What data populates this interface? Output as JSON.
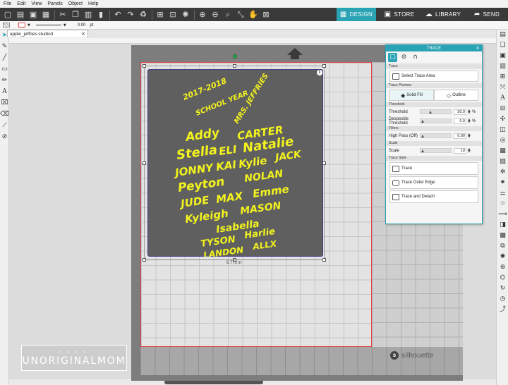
{
  "menu": [
    "File",
    "Edit",
    "View",
    "Panels",
    "Object",
    "Help"
  ],
  "nav_tabs": [
    {
      "label": "DESIGN",
      "active": true
    },
    {
      "label": "STORE",
      "active": false
    },
    {
      "label": "LIBRARY",
      "active": false
    },
    {
      "label": "SEND",
      "active": false
    }
  ],
  "properties": {
    "line_width": "0.00",
    "line_unit": "pt"
  },
  "document_tab": "apple_jeffries.studio3",
  "artwork": {
    "header": [
      "2017-2018",
      "SCHOOL YEAR",
      "MRS. JEFFRIES"
    ],
    "names": [
      "Addy",
      "CARTER",
      "Stella",
      "ELI",
      "Natalie",
      "JONNY",
      "KAI",
      "Kylie",
      "JACK",
      "Peyton",
      "NOLAN",
      "JUDE",
      "MAX",
      "Emme",
      "Kyleigh",
      "MASON",
      "Isabella",
      "TYSON",
      "Harlie",
      "LANDON",
      "ALLX"
    ],
    "width_label": "8.773 in"
  },
  "brand": "silhouette",
  "watermark": "UNORIGINALMOM",
  "trace_panel": {
    "title": "TRACE",
    "sections": {
      "trace": "Trace",
      "preview": "Trace Preview",
      "threshold": "Threshold",
      "filters": "Filters",
      "scale": "Scale",
      "style": "Trace Style"
    },
    "select_area": "Select Trace Area",
    "preview_options": [
      "Solid Fill",
      "Outline"
    ],
    "threshold": {
      "label": "Threshold",
      "value": "30.0",
      "unit": "%",
      "fraction": 0.3
    },
    "despeckle": {
      "label": "Despeckle Threshold",
      "value": "0.0",
      "unit": "%",
      "fraction": 0.0
    },
    "high_pass": {
      "label": "High Pass (Off)",
      "value": "0.00",
      "fraction": 0.0
    },
    "scale": {
      "label": "Scale",
      "value": "10",
      "fraction": 0.0
    },
    "trace_buttons": [
      "Trace",
      "Trace Outer Edge",
      "Trace and Detach"
    ]
  },
  "colors": {
    "accent": "#2aa3b5",
    "artwork_text": "#f2f21e",
    "artwork_bg": "#5f5f5f",
    "cut_border": "#e24040"
  }
}
